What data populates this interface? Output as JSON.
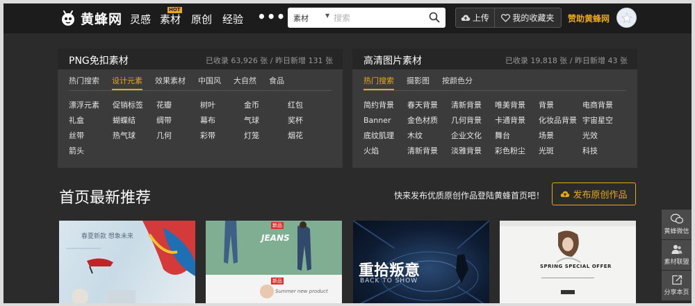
{
  "nav": {
    "logo_text": "黄蜂网",
    "links": [
      "灵感",
      "素材",
      "原创",
      "经验"
    ],
    "hot_badge": "HOT",
    "more": "•••",
    "search_category": "素材",
    "search_placeholder": "搜索",
    "upload_label": "上传",
    "favorites_label": "我的收藏夹",
    "sponsor_label": "赞助黄蜂网"
  },
  "png_panel": {
    "title": "PNG免扣素材",
    "stats": "已收录 63,926 张 / 昨日新增 131 张",
    "tabs": [
      "热门搜索",
      "设计元素",
      "效果素材",
      "中国风",
      "大自然",
      "食品"
    ],
    "items": [
      "漂浮元素",
      "促销标签",
      "花瓣",
      "树叶",
      "金币",
      "红包",
      "礼盒",
      "蝴蝶结",
      "绸带",
      "幕布",
      "气球",
      "奖杯",
      "丝带",
      "热气球",
      "几何",
      "彩带",
      "灯笼",
      "烟花",
      "箭头"
    ]
  },
  "hd_panel": {
    "title": "高清图片素材",
    "stats": "已收录 19,818 张 / 昨日新增 43 张",
    "tabs": [
      "热门搜索",
      "摄影图",
      "按颜色分"
    ],
    "items": [
      "简约背景",
      "春天背景",
      "清新背景",
      "唯美背景",
      "背景",
      "电商背景",
      "Banner",
      "金色材质",
      "几何背景",
      "卡通背景",
      "化妆品背景",
      "宇宙星空",
      "底纹肌理",
      "木纹",
      "企业文化",
      "舞台",
      "场景",
      "光效",
      "火焰",
      "清新背景",
      "淡雅背景",
      "彩色粉尘",
      "光斑",
      "科技"
    ]
  },
  "section": {
    "title": "首页最新推荐",
    "promo": "快来发布优质原创作品登陆黄蜂首页吧！",
    "publish_label": "发布原创作品"
  },
  "thumbs": {
    "t1_text": "春夏新款 想象未来",
    "t2_text": "JEANS",
    "t2_tag": "新品",
    "t2_caption": "Summer new product",
    "t3_text": "重拾叛意",
    "t3_sub": "BACK TO SHOW",
    "t4_text": "SPRING SPECIAL OFFER"
  },
  "sidebar": {
    "items": [
      "黄蜂微信",
      "素材联盟",
      "分享本页"
    ]
  },
  "colors": {
    "accent": "#e8a819",
    "nav_bg": "#1c1c1c",
    "page_bg": "#2b2b2b",
    "panel_bg": "#3b3b3b"
  }
}
